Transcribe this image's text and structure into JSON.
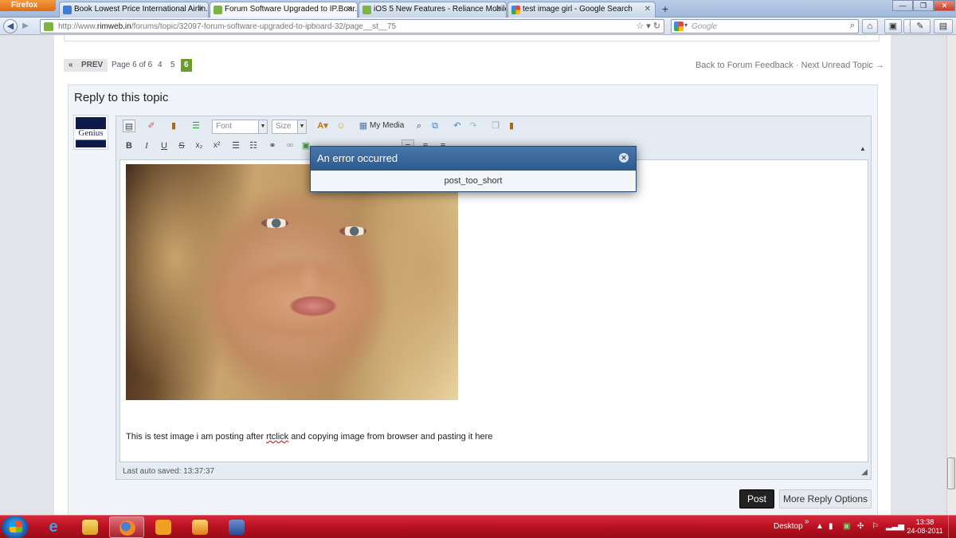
{
  "browser": {
    "app_button": "Firefox",
    "tabs": [
      {
        "title": "Book Lowest Price International Airlin...",
        "active": false
      },
      {
        "title": "Forum Software Upgraded to IP.Boar...",
        "active": true
      },
      {
        "title": "iOS 5 New Features - Reliance Mobile...",
        "active": false
      },
      {
        "title": "test image girl - Google Search",
        "active": false
      }
    ],
    "new_tab": "+",
    "url_prefix": "http://www.",
    "url_domain": "rimweb.in",
    "url_rest": "/forums/topic/32097-forum-software-upgraded-to-ipboard-32/page__st__75",
    "search_placeholder": "Google"
  },
  "pager": {
    "first": "«",
    "prev": "PREV",
    "page_info": "Page 6 of 6",
    "pages": [
      "4",
      "5"
    ],
    "current": "6",
    "back_link": "Back to Forum Feedback",
    "separator": "·",
    "next_link": "Next Unread Topic →"
  },
  "reply": {
    "title": "Reply to this topic",
    "avatar_text": "Genius",
    "font_select": "Font",
    "size_select": "Size",
    "my_media": "My Media",
    "body_text_before": "This is test image i am posting after ",
    "body_text_misspelled": "rtclick",
    "body_text_after": " and copying image from browser and pasting it here",
    "autosave": "Last auto saved: 13:37:37",
    "post_button": "Post",
    "more_button": "More Reply Options"
  },
  "dialog": {
    "title": "An error occurred",
    "message": "post_too_short"
  },
  "taskbar": {
    "desktop": "Desktop",
    "time": "13:38",
    "date": "24-08-2011"
  },
  "colors": {
    "taskbar": "#c41a2b",
    "dialog_header": "#3a6a9e",
    "current_page": "#6c9b2e"
  }
}
